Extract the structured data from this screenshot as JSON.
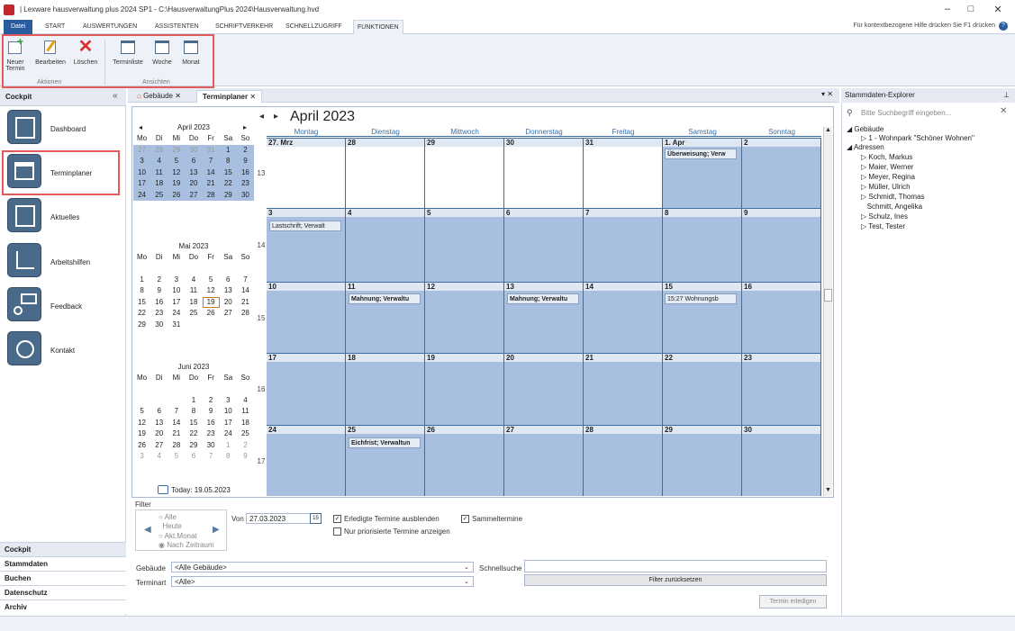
{
  "window": {
    "title": "| Lexware hausverwaltung plus 2024 SP1 - C:\\HausverwaltungPlus 2024\\Hausverwaltung.hvd",
    "min": "–",
    "max": "□",
    "close": "✕"
  },
  "menu": {
    "tabs": [
      "Datei",
      "START",
      "AUSWERTUNGEN",
      "ASSISTENTEN",
      "SCHRIFTVERKEHR",
      "SCHNELLZUGRIFF",
      "FUNKTIONEN"
    ],
    "help": "Für kontextbezogene Hilfe drücken Sie F1 drücken"
  },
  "ribbon": {
    "neuer": "Neuer Termin",
    "neuer1": "Neuer",
    "neuer2": "Termin",
    "bearbeiten": "Bearbeiten",
    "loeschen": "Löschen",
    "aktionen": "Aktionen",
    "terminliste": "Terminliste",
    "woche": "Woche",
    "monat": "Monat",
    "ansichten": "Ansichten"
  },
  "cockpit": {
    "title": "Cockpit",
    "collapse": "«",
    "items": [
      "Dashboard",
      "Terminplaner",
      "Aktuelles",
      "Arbeitshilfen",
      "Feedback",
      "Kontakt"
    ]
  },
  "bottomnav": [
    "Cockpit",
    "Stammdaten",
    "Buchen",
    "Datenschutz",
    "Archiv"
  ],
  "tabs": {
    "gebaeude": "Gebäude",
    "terminplaner": "Terminplaner",
    "close": "✕",
    "pin": "▾ ✕"
  },
  "calendar": {
    "title": "April 2023",
    "prev": "◂",
    "next": "▸",
    "days": [
      "Montag",
      "Dienstag",
      "Mittwoch",
      "Donnerstag",
      "Freitag",
      "Samstag",
      "Sonntag"
    ],
    "weeks": [
      {
        "num": "13",
        "dates": [
          "27. Mrz",
          "28",
          "29",
          "30",
          "31",
          "1. Apr",
          "2"
        ]
      },
      {
        "num": "14",
        "dates": [
          "3",
          "4",
          "5",
          "6",
          "7",
          "8",
          "9"
        ]
      },
      {
        "num": "15",
        "dates": [
          "10",
          "11",
          "12",
          "13",
          "14",
          "15",
          "16"
        ]
      },
      {
        "num": "16",
        "dates": [
          "17",
          "18",
          "19",
          "20",
          "21",
          "22",
          "23"
        ]
      },
      {
        "num": "17",
        "dates": [
          "24",
          "25",
          "26",
          "27",
          "28",
          "29",
          "30"
        ]
      }
    ],
    "appointments": {
      "ueberweisung": "Überweisung; Verw",
      "lastschrift": "Lastschrift; Verwalt",
      "mahnung1": "Mahnung; Verwaltu",
      "mahnung2": "Mahnung; Verwaltu",
      "wohnung": "15:27 Wohnungsb",
      "eichfrist": "Eichfrist; Verwaltun"
    }
  },
  "minical": {
    "april": {
      "title": "April 2023",
      "prev": "◂",
      "next": "▸",
      "head": [
        "Mo",
        "Di",
        "Mi",
        "Do",
        "Fr",
        "Sa",
        "So"
      ],
      "rows": [
        [
          "27",
          "28",
          "29",
          "30",
          "31",
          "1",
          "2"
        ],
        [
          "3",
          "4",
          "5",
          "6",
          "7",
          "8",
          "9"
        ],
        [
          "10",
          "11",
          "12",
          "13",
          "14",
          "15",
          "16"
        ],
        [
          "17",
          "18",
          "19",
          "20",
          "21",
          "22",
          "23"
        ],
        [
          "24",
          "25",
          "26",
          "27",
          "28",
          "29",
          "30"
        ]
      ]
    },
    "mai": {
      "title": "Mai 2023",
      "head": [
        "Mo",
        "Di",
        "Mi",
        "Do",
        "Fr",
        "Sa",
        "So"
      ],
      "rows": [
        [
          "1",
          "2",
          "3",
          "4",
          "5",
          "6",
          "7"
        ],
        [
          "8",
          "9",
          "10",
          "11",
          "12",
          "13",
          "14"
        ],
        [
          "15",
          "16",
          "17",
          "18",
          "19",
          "20",
          "21"
        ],
        [
          "22",
          "23",
          "24",
          "25",
          "26",
          "27",
          "28"
        ],
        [
          "29",
          "30",
          "31",
          "",
          "",
          "",
          ""
        ]
      ]
    },
    "juni": {
      "title": "Juni 2023",
      "head": [
        "Mo",
        "Di",
        "Mi",
        "Do",
        "Fr",
        "Sa",
        "So"
      ],
      "rows": [
        [
          "",
          "",
          "",
          "1",
          "2",
          "3",
          "4"
        ],
        [
          "5",
          "6",
          "7",
          "8",
          "9",
          "10",
          "11"
        ],
        [
          "12",
          "13",
          "14",
          "15",
          "16",
          "17",
          "18"
        ],
        [
          "19",
          "20",
          "21",
          "22",
          "23",
          "24",
          "25"
        ],
        [
          "26",
          "27",
          "28",
          "29",
          "30",
          "1",
          "2"
        ],
        [
          "3",
          "4",
          "5",
          "6",
          "7",
          "8",
          "9"
        ]
      ]
    },
    "today": "Today: 19.05.2023"
  },
  "filter": {
    "label": "Filter",
    "alle": "Alle",
    "heute": "Heute",
    "aktmonat": "Akt.Monat",
    "zeitraum": "Nach Zeitraum",
    "von": "Von",
    "vondate": "27.03.2023",
    "erledigte": "Erledigte Termine ausblenden",
    "sammel": "Sammeltermine",
    "nurprio": "Nur priorisierte Termine anzeigen",
    "gebaeude": "Gebäude",
    "gebaeudeval": "<Alle Gebäude>",
    "schnellsuche": "Schnellsuche",
    "terminart": "Terminart",
    "terminartval": "<Alle>",
    "reset": "Filter zurücksetzen",
    "erledigen": "Termin erledigen"
  },
  "explorer": {
    "title": "Stammdaten-Explorer",
    "pin": "⊥",
    "search": "Bitte Suchbegriff eingeben...",
    "gebaeude": "Gebäude",
    "wohnpark": "1 - Wohnpark \"Schöner Wohnen\"",
    "adressen": "Adressen",
    "names": [
      "Koch, Markus",
      "Maier, Werner",
      "Meyer, Regina",
      "Müller, Ulrich",
      "Schmidt, Thomas",
      "Schmitt, Angelika",
      "Schulz, Ines",
      "Test, Tester"
    ]
  },
  "colors": {
    "accent": "#2a5b9c",
    "cellfill": "#a8bfdf",
    "highlight": "#e35a5a"
  }
}
